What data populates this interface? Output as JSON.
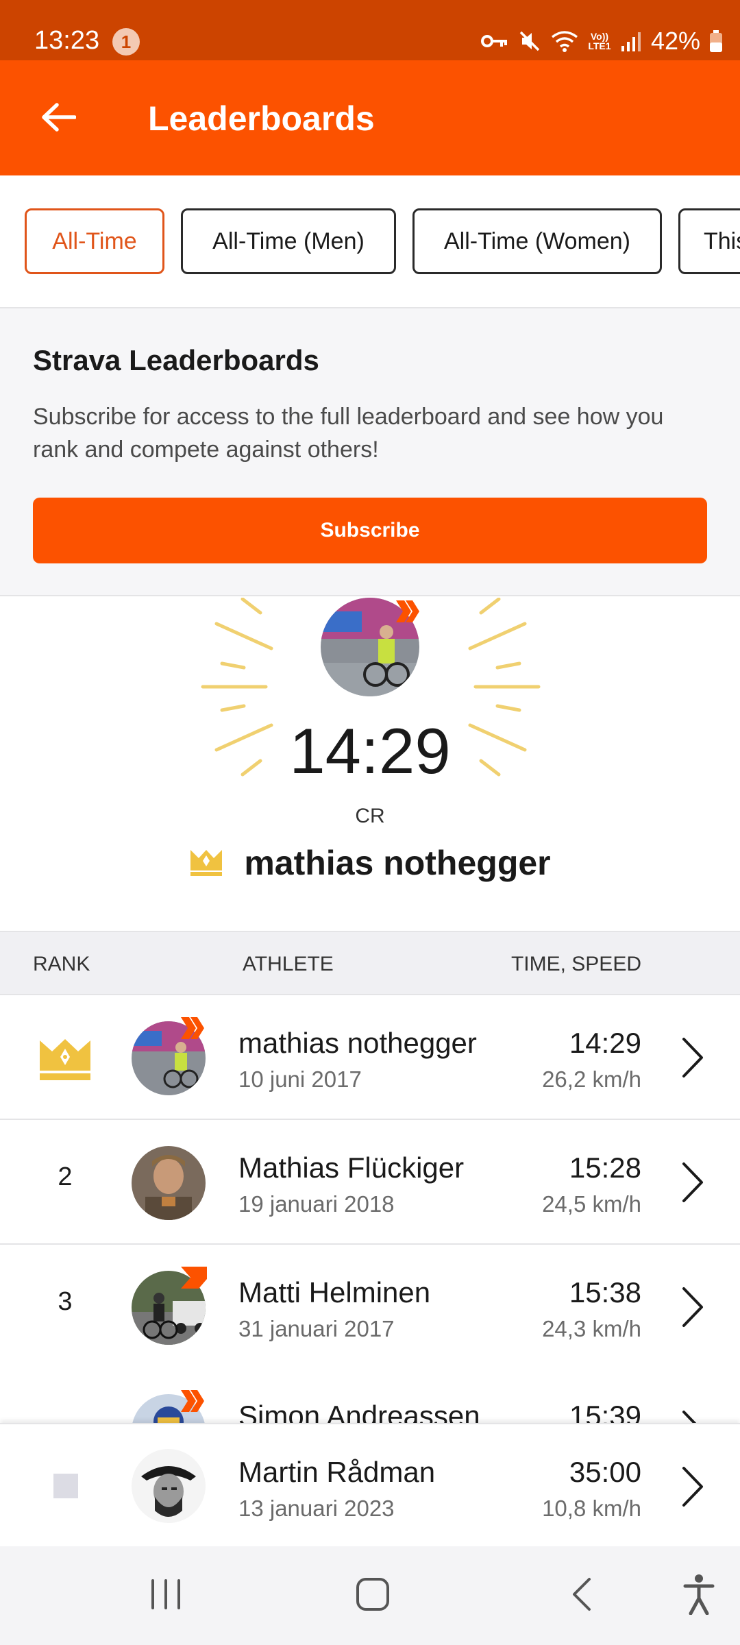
{
  "status_bar": {
    "time": "13:23",
    "notification_count": "1",
    "network_label": "Vo)) LTE1",
    "battery": "42%"
  },
  "header": {
    "title": "Leaderboards"
  },
  "filters": [
    {
      "label": "All-Time",
      "active": true
    },
    {
      "label": "All-Time (Men)",
      "active": false
    },
    {
      "label": "All-Time (Women)",
      "active": false
    },
    {
      "label": "This",
      "active": false
    }
  ],
  "promo": {
    "title": "Strava Leaderboards",
    "description": "Subscribe for access to the full leaderboard and see how you rank and compete against others!",
    "button_label": "Subscribe"
  },
  "leader": {
    "time": "14:29",
    "label": "CR",
    "name": "mathias nothegger"
  },
  "table": {
    "columns": [
      "RANK",
      "ATHLETE",
      "TIME, SPEED"
    ],
    "rows": [
      {
        "rank": "",
        "crown": true,
        "name": "mathias nothegger",
        "date": "10 juni 2017",
        "time": "14:29",
        "speed": "26,2 km/h",
        "subscriber_badge": "double"
      },
      {
        "rank": "2",
        "crown": false,
        "name": "Mathias Flückiger",
        "date": "19 januari 2018",
        "time": "15:28",
        "speed": "24,5 km/h",
        "subscriber_badge": "none"
      },
      {
        "rank": "3",
        "crown": false,
        "name": "Matti Helminen",
        "date": "31 januari 2017",
        "time": "15:38",
        "speed": "24,3 km/h",
        "subscriber_badge": "single"
      },
      {
        "rank": "",
        "crown": false,
        "name": "Simon Andreassen",
        "date": "",
        "time": "15:39",
        "speed": "",
        "subscriber_badge": "double"
      }
    ],
    "current_user": {
      "rank": "",
      "name": "Martin Rådman",
      "date": "13 januari 2023",
      "time": "35:00",
      "speed": "10,8 km/h"
    }
  },
  "colors": {
    "brand": "#fc5200",
    "status_bar": "#cc4400",
    "crown": "#f0c240"
  },
  "icons": {
    "back": "arrow-left-icon",
    "crown": "crown-icon",
    "chevron": "chevron-right-icon",
    "nav_recents": "recents-icon",
    "nav_home": "home-icon",
    "nav_back": "back-icon",
    "nav_accessibility": "accessibility-icon"
  }
}
